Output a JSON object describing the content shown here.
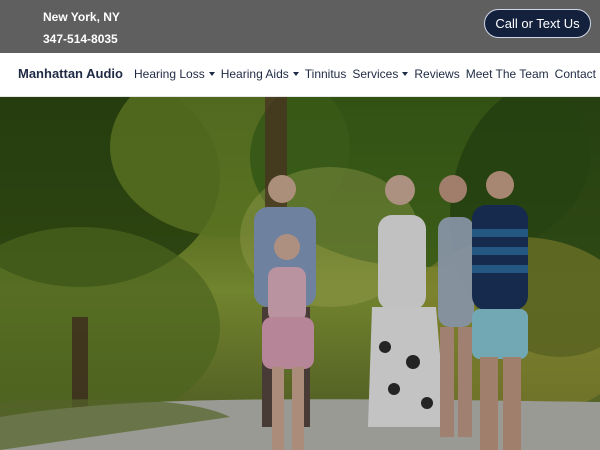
{
  "topbar": {
    "city": "New York, NY",
    "phone": "347-514-8035",
    "cta_label": "Call or Text Us",
    "background": "#5f5f5f",
    "cta_background": "#14213d"
  },
  "navbar": {
    "brand": "Manhattan Audio",
    "items": [
      {
        "label": "Hearing Loss",
        "has_dropdown": true
      },
      {
        "label": "Hearing Aids",
        "has_dropdown": true
      },
      {
        "label": "Tinnitus",
        "has_dropdown": false
      },
      {
        "label": "Services",
        "has_dropdown": true
      },
      {
        "label": "Reviews",
        "has_dropdown": false
      },
      {
        "label": "Meet The Team",
        "has_dropdown": false
      },
      {
        "label": "Contact",
        "has_dropdown": true
      }
    ],
    "text_color": "#1f2a44"
  }
}
